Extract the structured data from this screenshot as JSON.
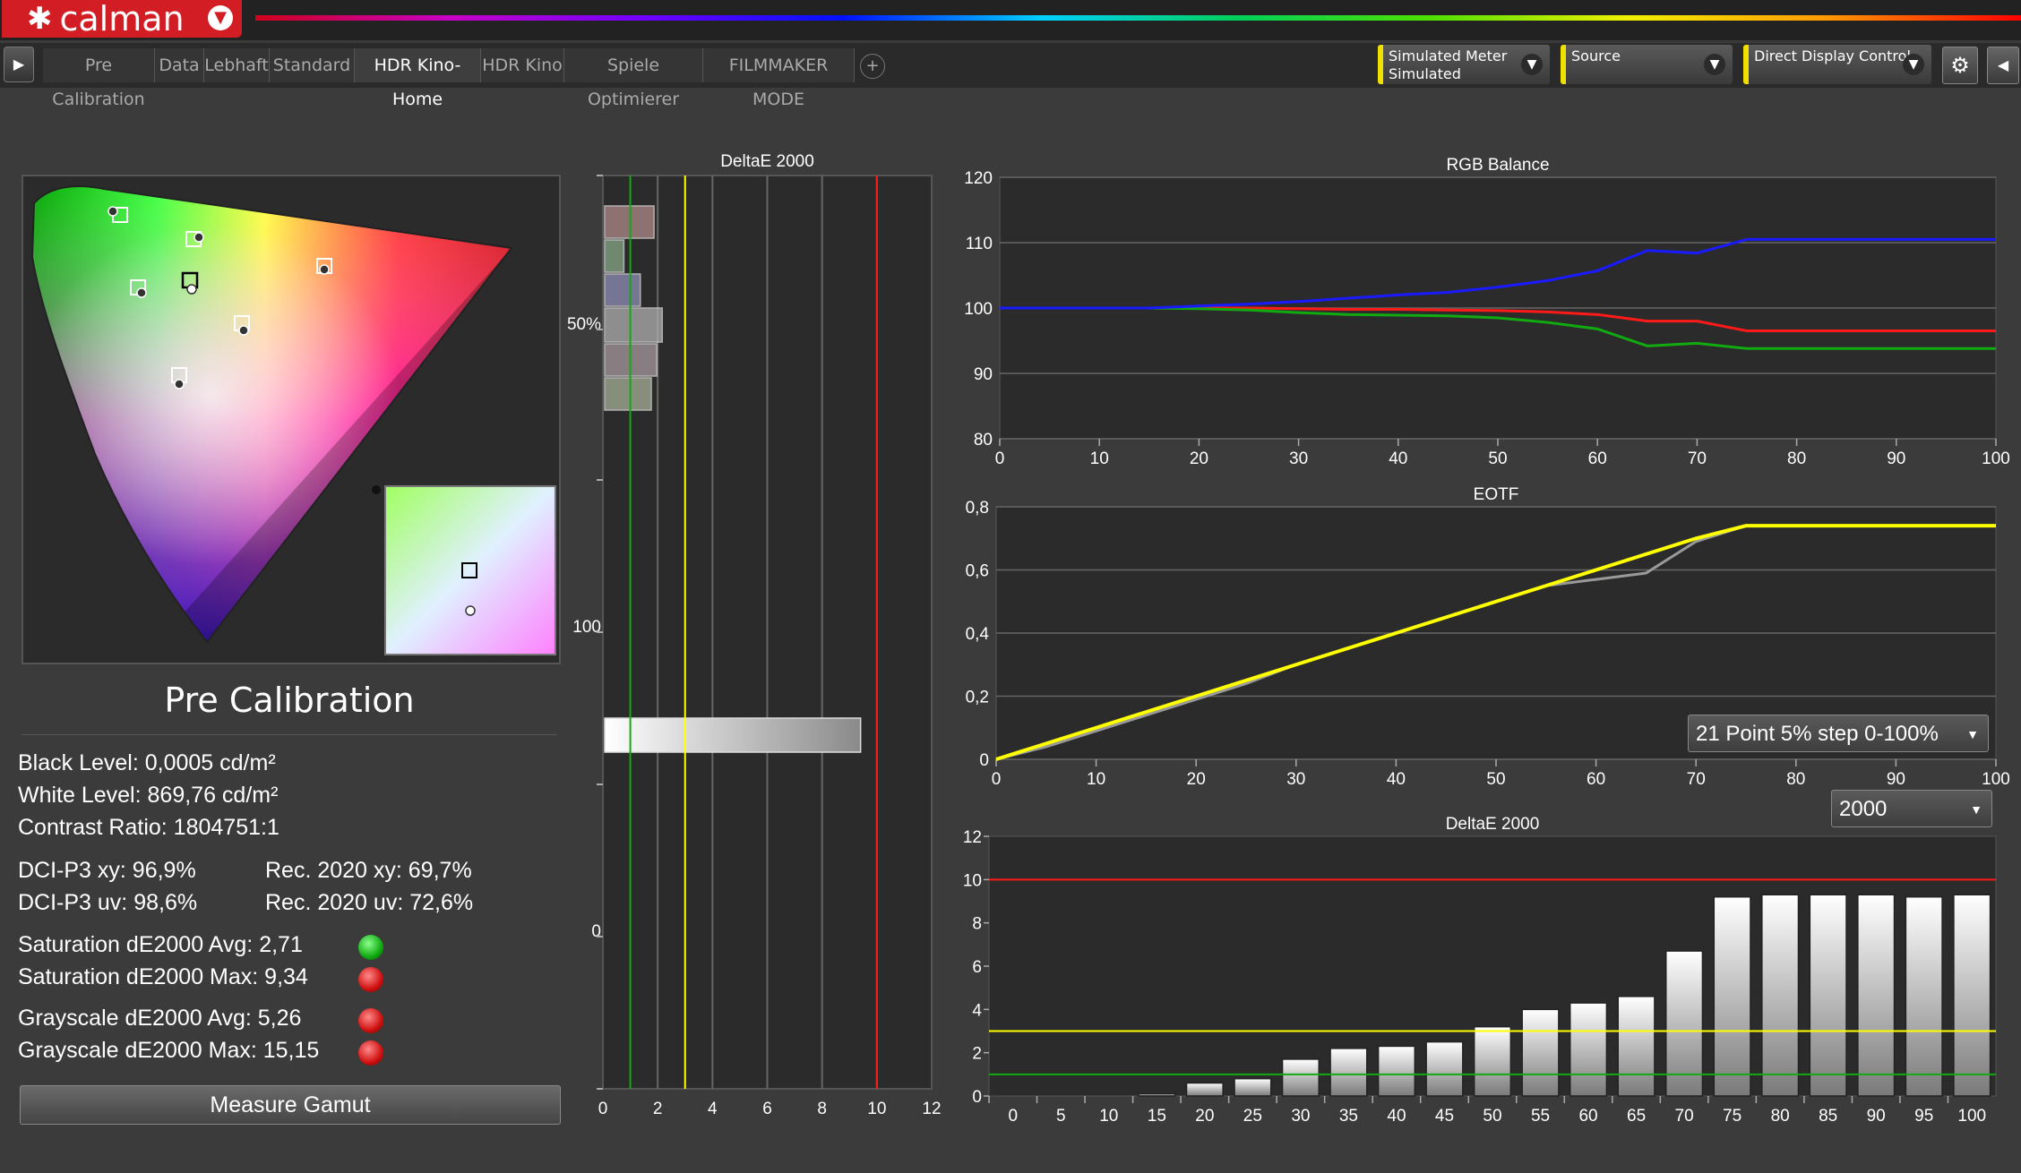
{
  "app": {
    "logo_mark": "✱",
    "name": "calman",
    "menu_icon": "chevron-down-icon"
  },
  "tabs": [
    {
      "label": "Pre Calibration",
      "active": false
    },
    {
      "label": "Data",
      "active": false
    },
    {
      "label": "Lebhaft",
      "active": false
    },
    {
      "label": "Standard",
      "active": false
    },
    {
      "label": "HDR Kino-Home",
      "active": true
    },
    {
      "label": "HDR Kino",
      "active": false
    },
    {
      "label": "Spiele Optimierer",
      "active": false
    },
    {
      "label": "FILMMAKER MODE",
      "active": false
    }
  ],
  "add_tab": "+",
  "controls": {
    "meter": {
      "line1": "Simulated Meter",
      "line2": "Simulated"
    },
    "source": {
      "line1": "Source",
      "line2": ""
    },
    "display": {
      "line1": "Direct Display Control",
      "line2": ""
    }
  },
  "colors": {
    "accent": "#f0e000",
    "brand": "#d21d24",
    "red": "#ff1a1a",
    "green": "#11aa11",
    "blue": "#1a1aff",
    "yellow": "#ffff00"
  },
  "panel": {
    "title": "Pre Calibration",
    "black_level": "Black Level: 0,0005 cd/m²",
    "white_level": "White Level: 869,76 cd/m²",
    "contrast": "Contrast Ratio: 1804751:1",
    "dci_xy": "DCI-P3 xy: 96,9%",
    "dci_uv": "DCI-P3 uv: 98,6%",
    "rec_xy": "Rec. 2020 xy: 69,7%",
    "rec_uv": "Rec. 2020 uv: 72,6%",
    "sat_avg": "Saturation dE2000 Avg: 2,71",
    "sat_max": "Saturation dE2000 Max: 9,34",
    "gray_avg": "Grayscale dE2000 Avg: 5,26",
    "gray_max": "Grayscale dE2000 Max: 15,15",
    "sat_avg_status": "green",
    "sat_max_status": "red",
    "gray_avg_status": "red",
    "gray_max_status": "red",
    "measure_button": "Measure Gamut"
  },
  "dropdowns": {
    "pattern": "21 Point 5% step 0-100%",
    "de_formula": "2000"
  },
  "chart_data": [
    {
      "type": "bar",
      "title": "DeltaE 2000",
      "orientation": "horizontal",
      "xlim": [
        0,
        12
      ],
      "xticks": [
        "0",
        "2",
        "4",
        "6",
        "8",
        "10",
        "12"
      ],
      "left_labels": [
        "50%",
        "100",
        "0"
      ],
      "threshold_lines": [
        {
          "value": 1,
          "color": "#11aa11"
        },
        {
          "value": 3,
          "color": "#ffff00"
        },
        {
          "value": 10,
          "color": "#ff1a1a"
        }
      ],
      "bars": [
        {
          "value": 1.8,
          "color": "#b08a8a"
        },
        {
          "value": 0.7,
          "color": "#86a886"
        },
        {
          "value": 1.3,
          "color": "#9090b8"
        },
        {
          "value": 2.1,
          "color": "#b0b0b0"
        },
        {
          "value": 1.9,
          "color": "#a89aa0"
        },
        {
          "value": 1.7,
          "color": "#a8b098"
        },
        {
          "value": 9.34,
          "color": "#e8e8e8"
        }
      ]
    },
    {
      "type": "line",
      "title": "RGB Balance",
      "xlim": [
        0,
        100
      ],
      "ylim": [
        80,
        120
      ],
      "xticks": [
        "0",
        "10",
        "20",
        "30",
        "40",
        "50",
        "60",
        "70",
        "80",
        "90",
        "100"
      ],
      "yticks": [
        "80",
        "90",
        "100",
        "110",
        "120"
      ],
      "x": [
        0,
        5,
        10,
        15,
        20,
        25,
        30,
        35,
        40,
        45,
        50,
        55,
        60,
        65,
        70,
        75,
        80,
        85,
        90,
        95,
        100
      ],
      "series": [
        {
          "name": "Red",
          "color": "#ff1a1a",
          "values": [
            100,
            100,
            100,
            100,
            100,
            100,
            99.9,
            99.8,
            99.8,
            99.7,
            99.6,
            99.4,
            99,
            98,
            98,
            96.5,
            96.5,
            96.5,
            96.5,
            96.5,
            96.5
          ]
        },
        {
          "name": "Green",
          "color": "#11aa11",
          "values": [
            100,
            100,
            100,
            100,
            99.9,
            99.7,
            99.3,
            99,
            98.9,
            98.8,
            98.5,
            97.8,
            96.8,
            94.2,
            94.6,
            93.8,
            93.8,
            93.8,
            93.8,
            93.8,
            93.8
          ]
        },
        {
          "name": "Blue",
          "color": "#1a1aff",
          "values": [
            100,
            100,
            100,
            100,
            100.3,
            100.6,
            101,
            101.5,
            102,
            102.4,
            103.2,
            104.2,
            105.7,
            108.8,
            108.4,
            110.5,
            110.5,
            110.5,
            110.5,
            110.5,
            110.5
          ]
        }
      ]
    },
    {
      "type": "line",
      "title": "EOTF",
      "xlim": [
        0,
        100
      ],
      "ylim": [
        0,
        0.8
      ],
      "xticks": [
        "0",
        "10",
        "20",
        "30",
        "40",
        "50",
        "60",
        "70",
        "80",
        "90",
        "100"
      ],
      "yticks": [
        "0",
        "0,2",
        "0,4",
        "0,6",
        "0,8"
      ],
      "x": [
        0,
        5,
        10,
        15,
        20,
        25,
        30,
        35,
        40,
        45,
        50,
        55,
        60,
        65,
        70,
        75,
        80,
        85,
        90,
        95,
        100
      ],
      "series": [
        {
          "name": "Target",
          "color": "#ffff00",
          "values": [
            0,
            0.05,
            0.1,
            0.15,
            0.2,
            0.25,
            0.3,
            0.35,
            0.4,
            0.45,
            0.5,
            0.55,
            0.6,
            0.65,
            0.7,
            0.74,
            0.74,
            0.74,
            0.74,
            0.74,
            0.74
          ]
        },
        {
          "name": "Measured",
          "color": "#9a9a9a",
          "values": [
            0,
            0.04,
            0.09,
            0.14,
            0.19,
            0.24,
            0.3,
            0.35,
            0.4,
            0.45,
            0.5,
            0.55,
            0.57,
            0.59,
            0.69,
            0.74,
            0.74,
            0.74,
            0.74,
            0.74,
            0.74
          ]
        }
      ]
    },
    {
      "type": "bar",
      "title": "DeltaE 2000",
      "ylim": [
        0,
        12
      ],
      "yticks": [
        "0",
        "2",
        "4",
        "6",
        "8",
        "10",
        "12"
      ],
      "categories": [
        "0",
        "5",
        "10",
        "15",
        "20",
        "25",
        "30",
        "35",
        "40",
        "45",
        "50",
        "55",
        "60",
        "65",
        "70",
        "75",
        "80",
        "85",
        "90",
        "95",
        "100"
      ],
      "values": [
        0,
        0,
        0,
        0.1,
        0.6,
        0.8,
        1.7,
        2.2,
        2.3,
        2.5,
        3.2,
        4,
        4.3,
        4.6,
        6.7,
        9.2,
        9.3,
        9.3,
        9.3,
        9.2,
        9.3
      ],
      "threshold_lines": [
        {
          "value": 1,
          "color": "#11aa11"
        },
        {
          "value": 3,
          "color": "#ffff00"
        },
        {
          "value": 10,
          "color": "#ff1a1a"
        }
      ]
    }
  ]
}
